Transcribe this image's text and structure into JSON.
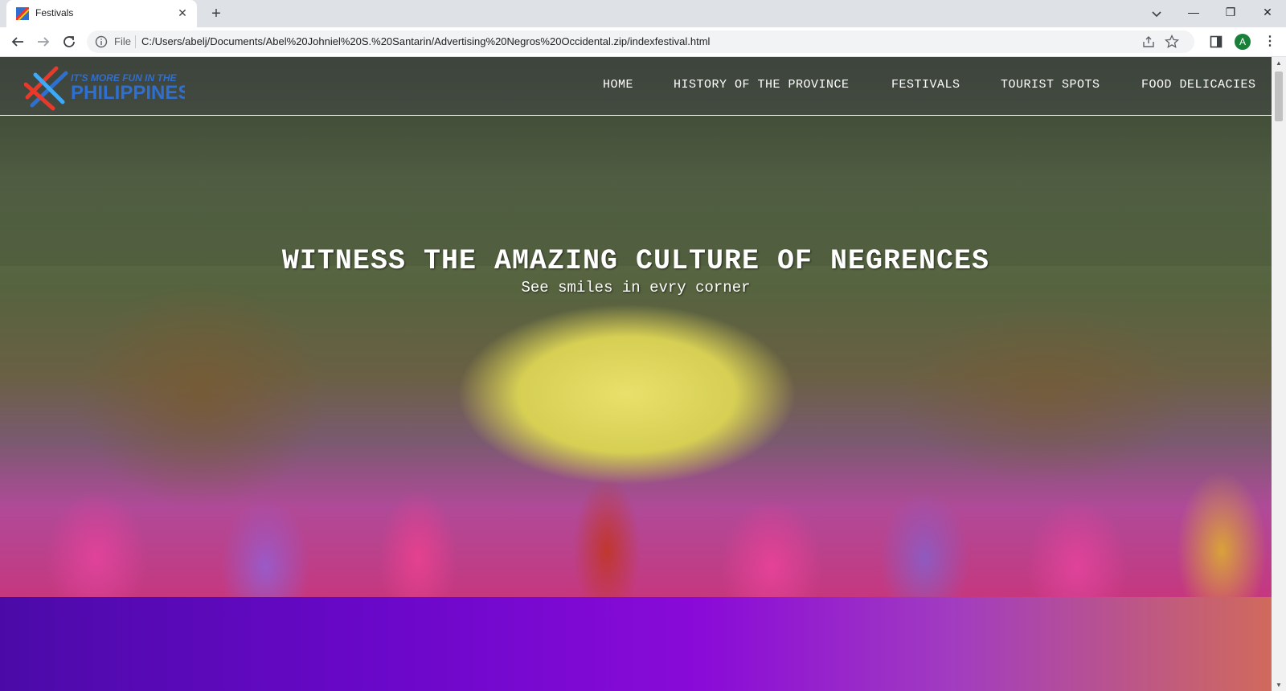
{
  "browser": {
    "tab_title": "Festivals",
    "tab_close": "✕",
    "new_tab": "+",
    "address_scheme": "File",
    "url": "C:/Users/abelj/Documents/Abel%20Johniel%20S.%20Santarin/Advertising%20Negros%20Occidental.zip/indexfestival.html",
    "avatar_letter": "A",
    "window_controls": {
      "minimize": "—",
      "restore": "❐",
      "close": "✕"
    }
  },
  "site": {
    "logo_alt": "It's More Fun in the Philippines",
    "nav": [
      "HOME",
      "HISTORY OF THE PROVINCE",
      "FESTIVALS",
      "TOURIST SPOTS",
      "FOOD DELICACIES"
    ]
  },
  "hero": {
    "title": "WITNESS THE AMAZING CULTURE OF NEGRENCES",
    "subtitle": "See smiles in evry corner"
  },
  "colors": {
    "tabbar": "#dee1e6",
    "avatar": "#188038",
    "purple_start": "#4b0aa8",
    "purple_end": "#d06a5c"
  }
}
